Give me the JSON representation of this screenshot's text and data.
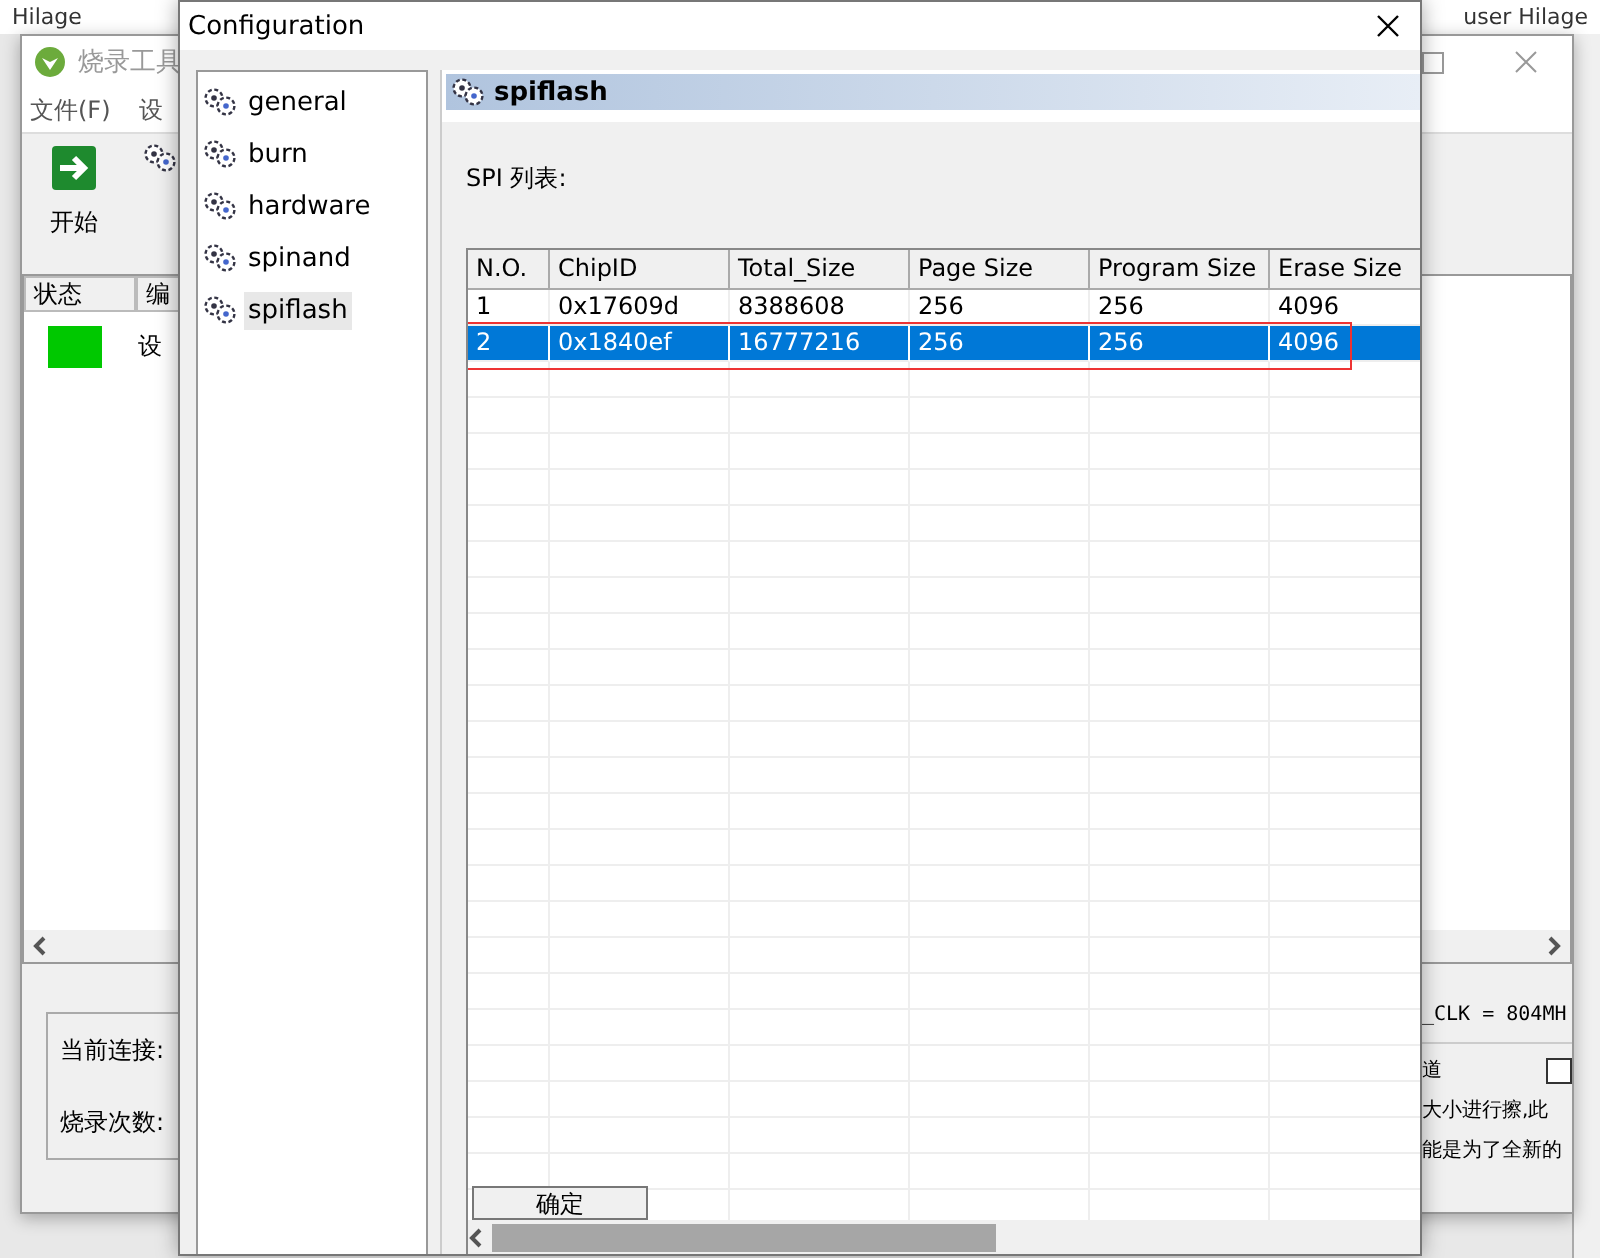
{
  "desktop": {
    "left_title": "Hilage",
    "right_title": "user   Hilage"
  },
  "main_window": {
    "title": "烧录工具",
    "menu": [
      "文件(F)",
      "设"
    ],
    "start_button": "开始",
    "list_columns": [
      "状态",
      "编"
    ],
    "list_rows": [
      {
        "color": "#00c800",
        "name": "设"
      }
    ],
    "connection_label": "当前连接:",
    "count_label": "烧录次数:",
    "log_line": "_CLK = 804MH",
    "option_label": "道",
    "option_checked": false,
    "notes": [
      "大小进行擦,此",
      "能是为了全新的"
    ]
  },
  "dialog": {
    "title": "Configuration",
    "tree": [
      {
        "label": "general",
        "selected": false
      },
      {
        "label": "burn",
        "selected": false
      },
      {
        "label": "hardware",
        "selected": false
      },
      {
        "label": "spinand",
        "selected": false
      },
      {
        "label": "spiflash",
        "selected": true
      }
    ],
    "section_title": "spiflash",
    "list_label": "SPI 列表:",
    "columns": [
      "N.O.",
      "ChipID",
      "Total_Size",
      "Page Size",
      "Program Size",
      "Erase Size"
    ],
    "rows": [
      {
        "cells": [
          "1",
          "0x17609d",
          "8388608",
          "256",
          "256",
          "4096"
        ],
        "selected": false,
        "outlined": false
      },
      {
        "cells": [
          "2",
          "0x1840ef",
          "16777216",
          "256",
          "256",
          "4096"
        ],
        "selected": true,
        "outlined": true
      }
    ],
    "ok_button": "确定"
  }
}
